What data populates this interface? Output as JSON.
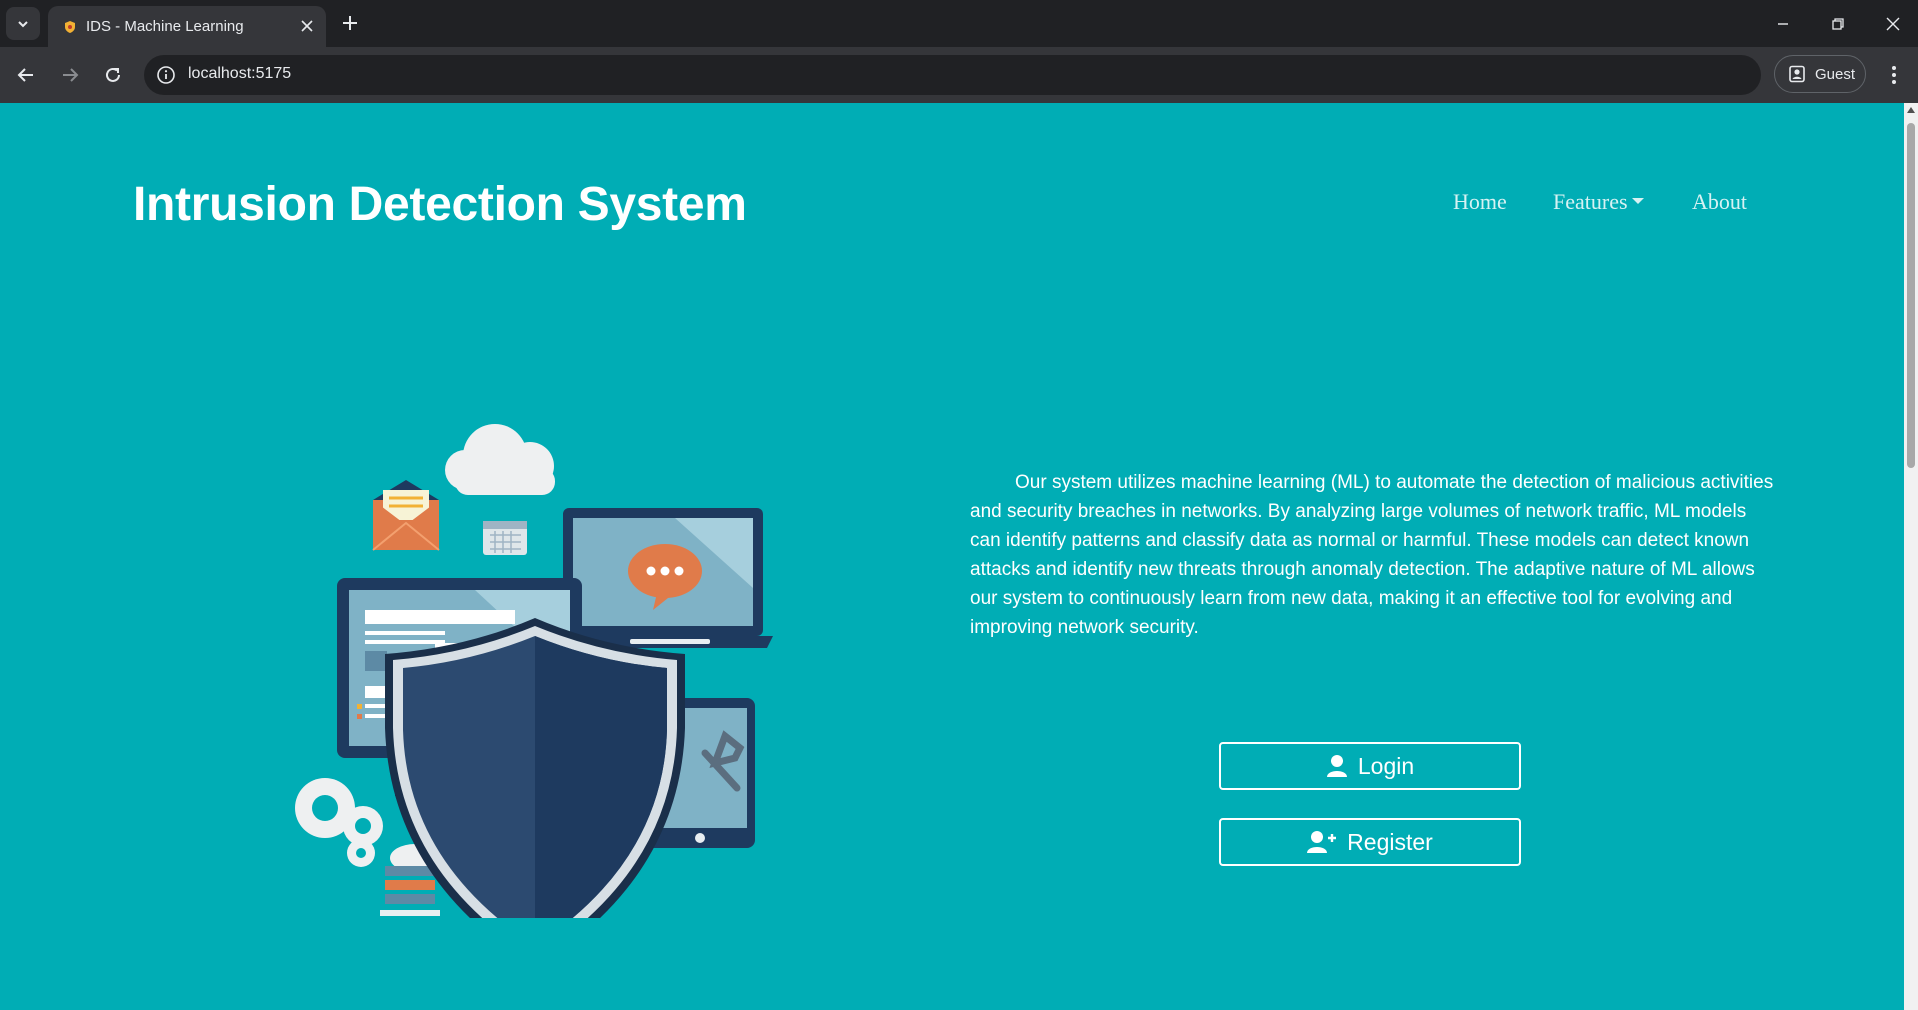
{
  "browser": {
    "tab_title": "IDS - Machine Learning",
    "url": "localhost:5175",
    "profile_label": "Guest"
  },
  "header": {
    "brand": "Intrusion Detection System",
    "nav": {
      "home": "Home",
      "features": "Features",
      "about": "About"
    }
  },
  "hero": {
    "description": "Our system utilizes machine learning (ML) to automate the detection of malicious activities and security breaches in networks. By analyzing large volumes of network traffic, ML models can identify patterns and classify data as normal or harmful. These models can detect known attacks and identify new threats through anomaly detection. The adaptive nature of ML allows our system to continuously learn from new data, making it an effective tool for evolving and improving network security.",
    "login_label": "Login",
    "register_label": "Register"
  },
  "colors": {
    "page_background": "#00adb5",
    "shield_dark": "#1e3a5f",
    "accent_orange": "#e07b4a"
  }
}
